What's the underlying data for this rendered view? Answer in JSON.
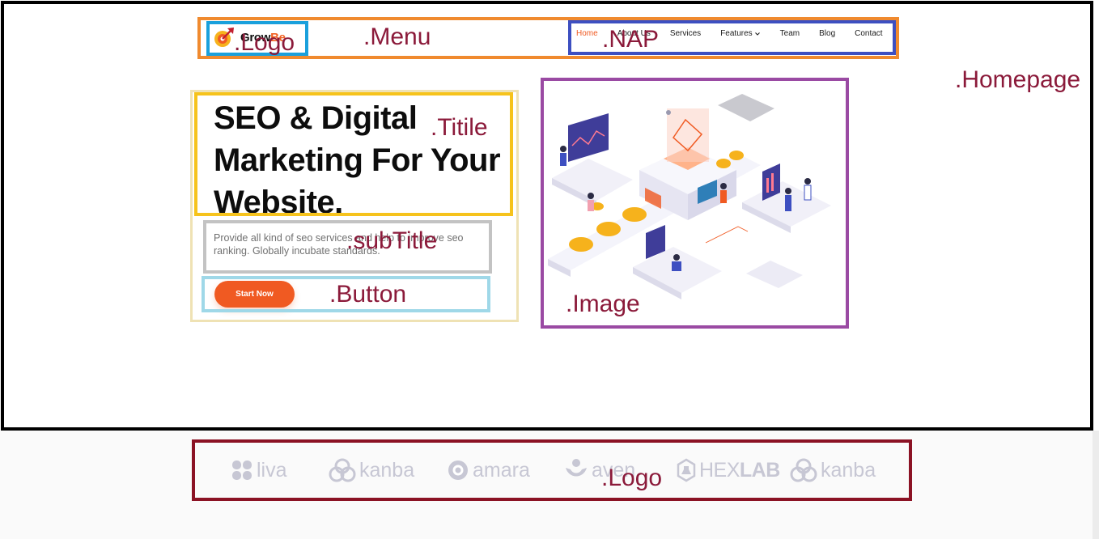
{
  "annotations": {
    "homepage": ".Homepage",
    "menu": ".Menu",
    "logo": ".Logo",
    "nap": ".NAP",
    "title": ".Titile",
    "subtitle": ".subTitle",
    "button": ".Button",
    "image": ".Image",
    "logo_strip": ".Logo"
  },
  "brand": {
    "name_dark": "Grow",
    "name_accent": "Be",
    "icon": "rocket-target-icon"
  },
  "nav": {
    "items": [
      {
        "label": "Home",
        "active": true
      },
      {
        "label": "About Us",
        "active": false
      },
      {
        "label": "Services",
        "active": false
      },
      {
        "label": "Features",
        "active": false,
        "has_dropdown": true
      },
      {
        "label": "Team",
        "active": false
      },
      {
        "label": "Blog",
        "active": false
      },
      {
        "label": "Contact",
        "active": false
      }
    ]
  },
  "hero": {
    "title": "SEO & Digital Marketing For Your Website.",
    "subtitle": "Provide all kind of seo services and help to improve seo ranking. Globally incubate standards.",
    "cta_label": "Start Now",
    "illustration": "isometric-seo-dashboard-illustration"
  },
  "partners": [
    {
      "name": "liva",
      "icon": "flower-icon"
    },
    {
      "name": "kanba",
      "icon": "rings-icon"
    },
    {
      "name": "amara",
      "icon": "at-icon"
    },
    {
      "name": "aven",
      "icon": "person-heart-icon"
    },
    {
      "name_light": "HEX",
      "name_bold": "LAB",
      "icon": "hexagon-flask-icon"
    },
    {
      "name": "kanba",
      "icon": "rings-icon"
    }
  ],
  "colors": {
    "accent": "#f05a22",
    "homepage_border": "#000000",
    "menu_border": "#f08a2e",
    "logo_border": "#1aa0dc",
    "nap_border": "#3d4fc1",
    "title_border": "#f6c31c",
    "subtitle_border": "#c3c3c3",
    "button_border": "#9fd8e8",
    "hero_border": "#efe2b4",
    "image_border": "#9a4aa3",
    "logo_strip_border": "#8b1224",
    "annotation_text": "#8b1a3a"
  }
}
